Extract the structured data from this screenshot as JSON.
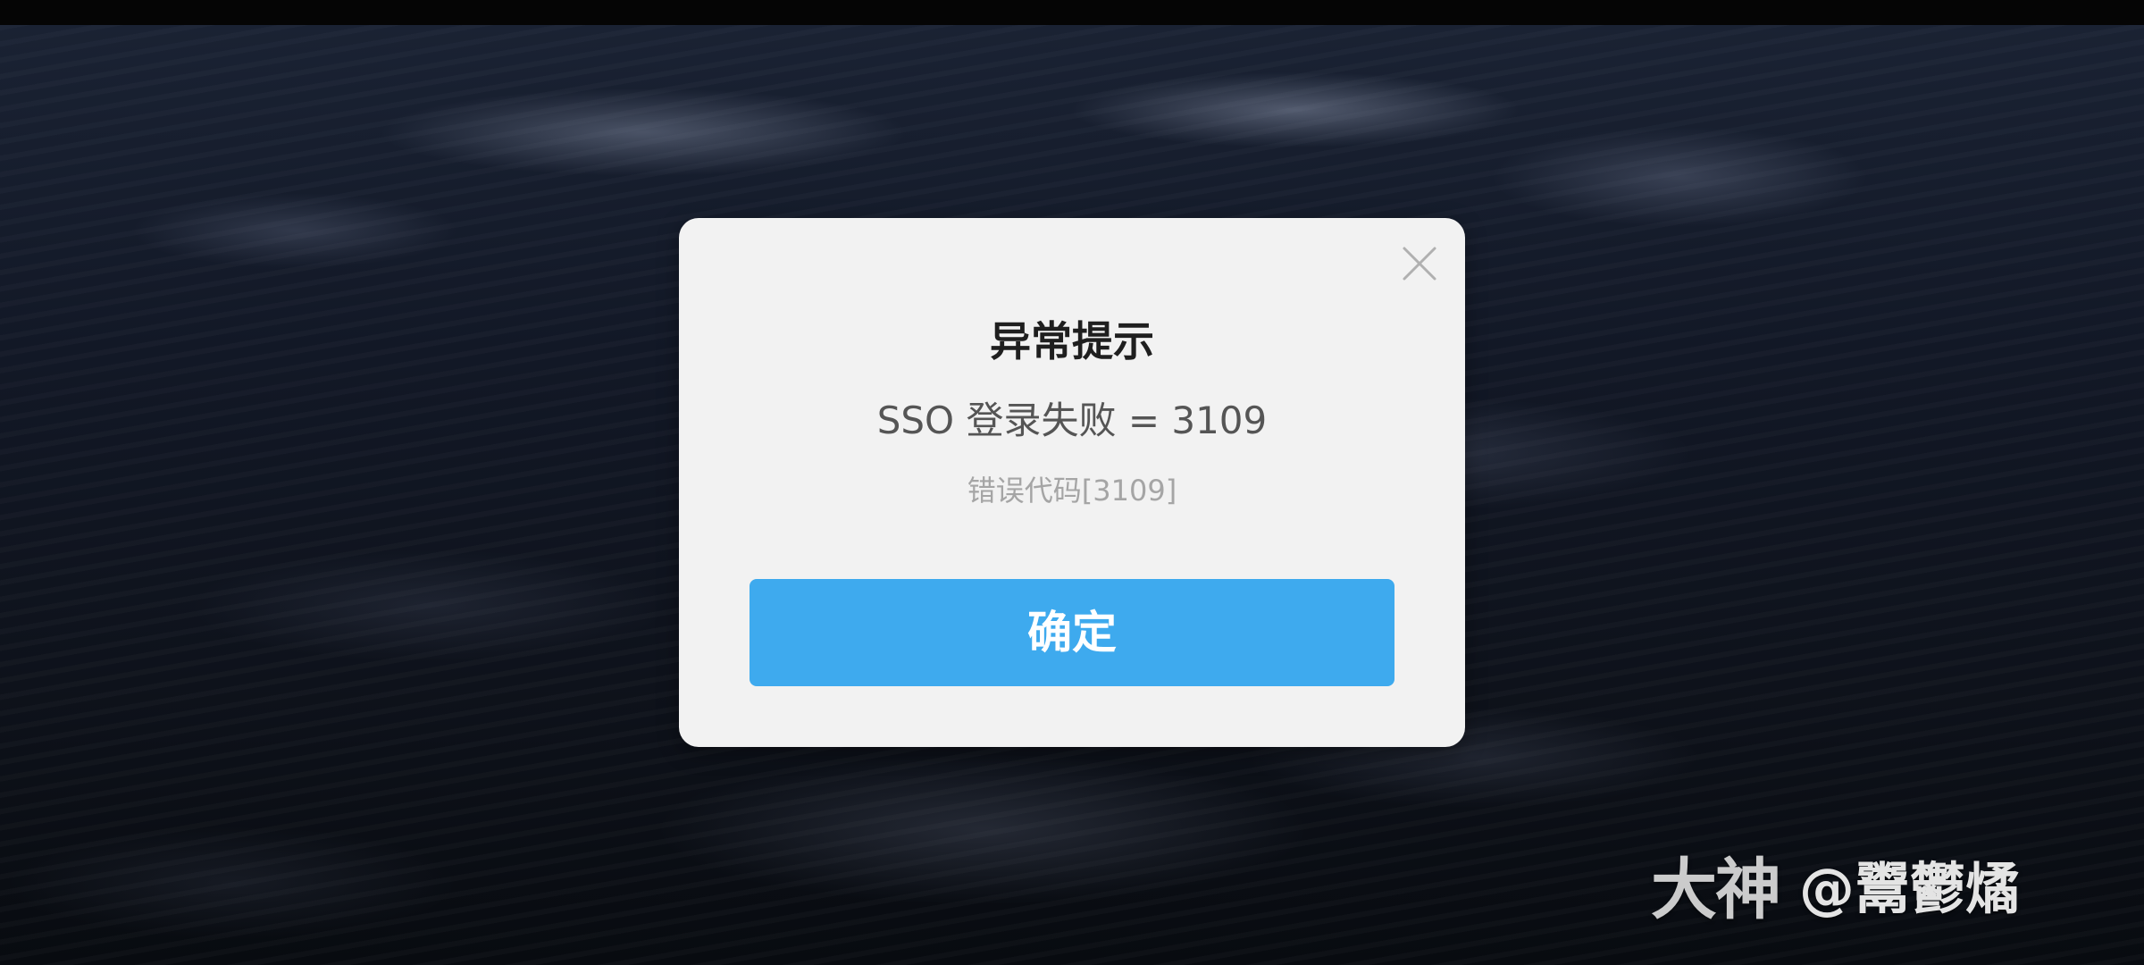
{
  "dialog": {
    "title": "异常提示",
    "message": "SSO 登录失败 = 3109",
    "error_code": "错误代码[3109]",
    "confirm_label": "确定",
    "close_icon": "close-icon"
  },
  "watermark": {
    "logo_text": "大神",
    "user_handle": "@鬻鬱燏"
  },
  "colors": {
    "dialog_background": "#f2f2f2",
    "confirm_button": "#3eaaee",
    "title_text": "#1f1f1f",
    "message_text": "#555555",
    "code_text": "#a5a5a5"
  }
}
